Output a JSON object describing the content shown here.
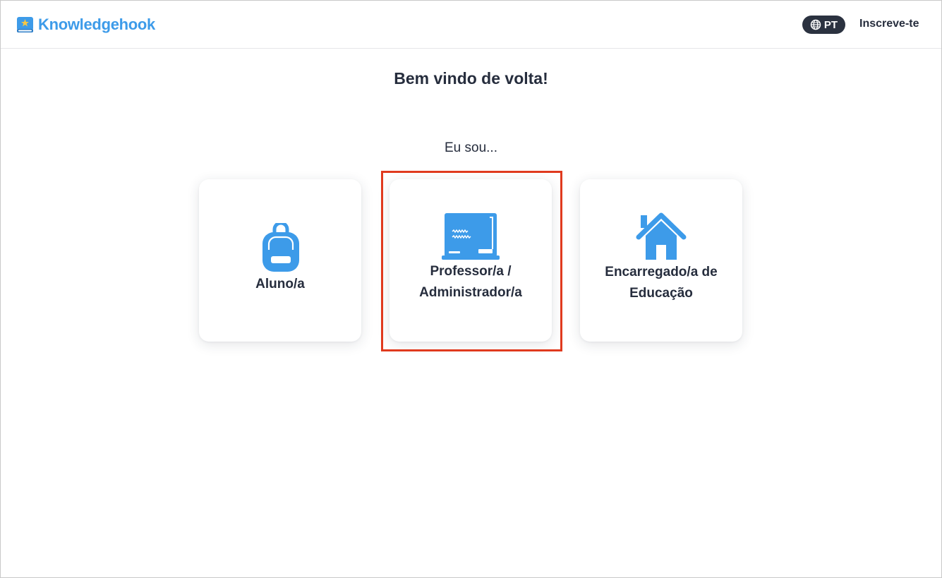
{
  "header": {
    "brand": "Knowledgehook",
    "brand_color": "#3d9be9",
    "language": "PT",
    "language_icon": "globe-icon",
    "signup_label": "Inscreve-te"
  },
  "main": {
    "title": "Bem vindo de volta!",
    "prompt": "Eu sou...",
    "roles": [
      {
        "label": "Aluno/a",
        "icon": "backpack-icon"
      },
      {
        "label_line1": "Professor/a /",
        "label_line2": "Administrador/a",
        "icon": "chalkboard-icon",
        "highlighted": true
      },
      {
        "label_line1": "Encarregado/a de",
        "label_line2": "Educação",
        "icon": "house-icon"
      }
    ]
  },
  "colors": {
    "accent": "#3d9be9",
    "text": "#262d3d",
    "highlight": "#e03a1e",
    "pill": "#2b3240"
  }
}
